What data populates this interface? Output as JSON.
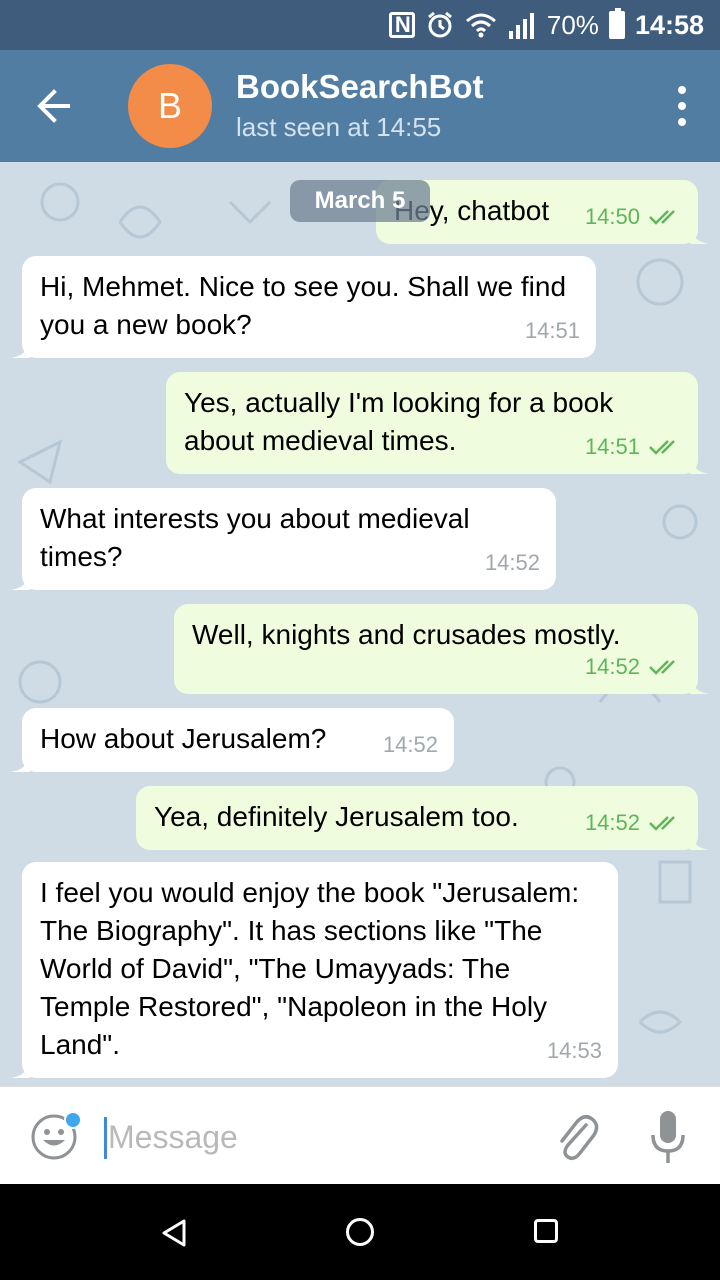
{
  "status_bar": {
    "battery": "70%",
    "time": "14:58",
    "icons": [
      "nfc-icon",
      "alarm-icon",
      "wifi-icon",
      "signal-icon",
      "battery-icon"
    ]
  },
  "header": {
    "avatar_letter": "B",
    "title": "BookSearchBot",
    "subtitle": "last seen at 14:55",
    "avatar_color": "#f28c48",
    "bar_color": "#527da3"
  },
  "date_pill": "March 5",
  "messages": [
    {
      "dir": "out",
      "text": "Hey, chatbot",
      "time": "14:50",
      "read": true
    },
    {
      "dir": "in",
      "text": "Hi, Mehmet. Nice to see you. Shall we find you a new book?",
      "time": "14:51"
    },
    {
      "dir": "out",
      "text": "Yes, actually I'm looking for a book about medieval times.",
      "time": "14:51",
      "read": true
    },
    {
      "dir": "in",
      "text": "What interests you about medieval times?",
      "time": "14:52"
    },
    {
      "dir": "out",
      "text": "Well, knights and crusades mostly.",
      "time": "14:52",
      "read": true
    },
    {
      "dir": "in",
      "text": "How about Jerusalem?",
      "time": "14:52"
    },
    {
      "dir": "out",
      "text": "Yea, definitely Jerusalem too.",
      "time": "14:52",
      "read": true
    },
    {
      "dir": "in",
      "text": "I feel you would enjoy the book \"Jerusalem: The Biography\". It has sections like \"The World of David\", \"The Umayyads: The Temple Restored\", \"Napoleon in the Holy Land\".",
      "time": "14:53"
    }
  ],
  "input": {
    "placeholder": "Message"
  }
}
